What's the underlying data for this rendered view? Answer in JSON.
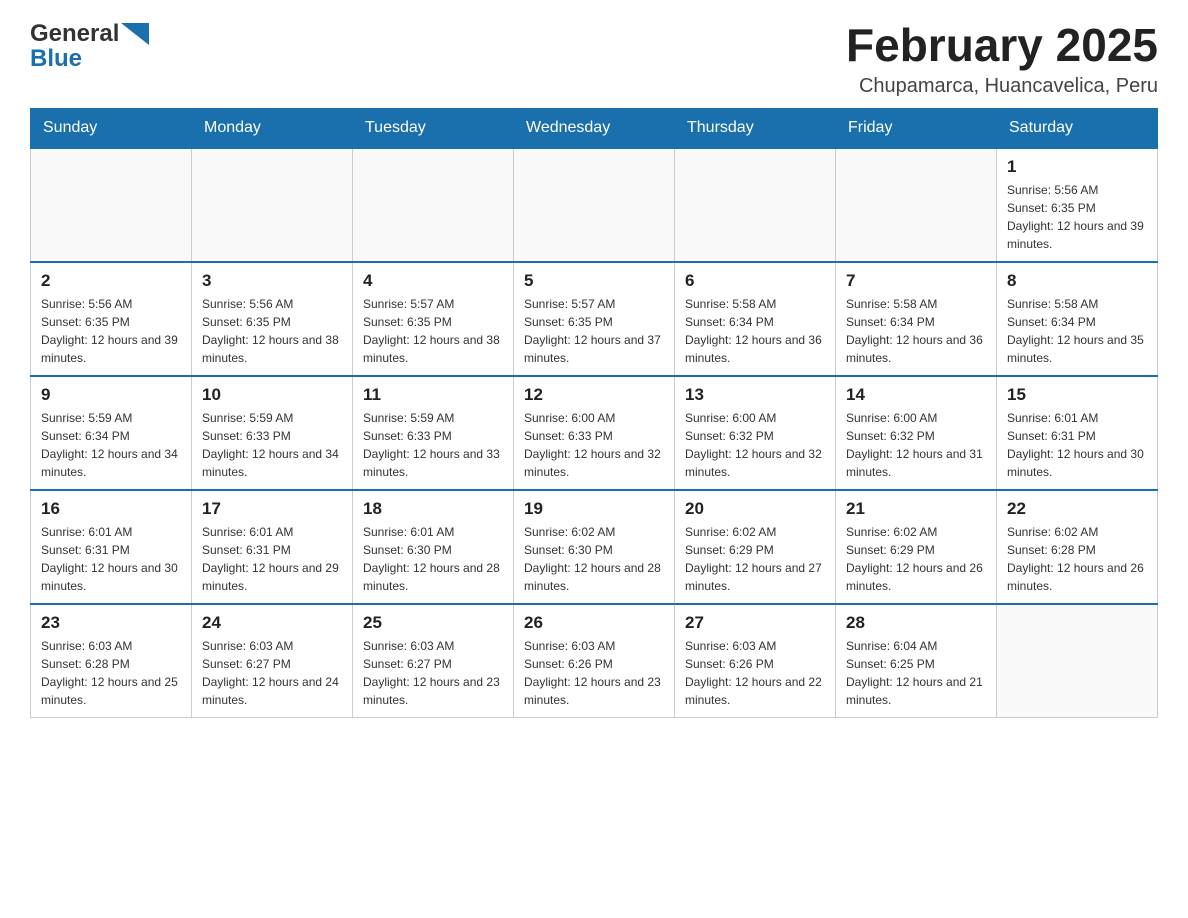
{
  "header": {
    "logo_line1": "General",
    "logo_line2": "Blue",
    "month_title": "February 2025",
    "location": "Chupamarca, Huancavelica, Peru"
  },
  "weekdays": [
    "Sunday",
    "Monday",
    "Tuesday",
    "Wednesday",
    "Thursday",
    "Friday",
    "Saturday"
  ],
  "weeks": [
    [
      {
        "day": "",
        "sunrise": "",
        "sunset": "",
        "daylight": ""
      },
      {
        "day": "",
        "sunrise": "",
        "sunset": "",
        "daylight": ""
      },
      {
        "day": "",
        "sunrise": "",
        "sunset": "",
        "daylight": ""
      },
      {
        "day": "",
        "sunrise": "",
        "sunset": "",
        "daylight": ""
      },
      {
        "day": "",
        "sunrise": "",
        "sunset": "",
        "daylight": ""
      },
      {
        "day": "",
        "sunrise": "",
        "sunset": "",
        "daylight": ""
      },
      {
        "day": "1",
        "sunrise": "Sunrise: 5:56 AM",
        "sunset": "Sunset: 6:35 PM",
        "daylight": "Daylight: 12 hours and 39 minutes."
      }
    ],
    [
      {
        "day": "2",
        "sunrise": "Sunrise: 5:56 AM",
        "sunset": "Sunset: 6:35 PM",
        "daylight": "Daylight: 12 hours and 39 minutes."
      },
      {
        "day": "3",
        "sunrise": "Sunrise: 5:56 AM",
        "sunset": "Sunset: 6:35 PM",
        "daylight": "Daylight: 12 hours and 38 minutes."
      },
      {
        "day": "4",
        "sunrise": "Sunrise: 5:57 AM",
        "sunset": "Sunset: 6:35 PM",
        "daylight": "Daylight: 12 hours and 38 minutes."
      },
      {
        "day": "5",
        "sunrise": "Sunrise: 5:57 AM",
        "sunset": "Sunset: 6:35 PM",
        "daylight": "Daylight: 12 hours and 37 minutes."
      },
      {
        "day": "6",
        "sunrise": "Sunrise: 5:58 AM",
        "sunset": "Sunset: 6:34 PM",
        "daylight": "Daylight: 12 hours and 36 minutes."
      },
      {
        "day": "7",
        "sunrise": "Sunrise: 5:58 AM",
        "sunset": "Sunset: 6:34 PM",
        "daylight": "Daylight: 12 hours and 36 minutes."
      },
      {
        "day": "8",
        "sunrise": "Sunrise: 5:58 AM",
        "sunset": "Sunset: 6:34 PM",
        "daylight": "Daylight: 12 hours and 35 minutes."
      }
    ],
    [
      {
        "day": "9",
        "sunrise": "Sunrise: 5:59 AM",
        "sunset": "Sunset: 6:34 PM",
        "daylight": "Daylight: 12 hours and 34 minutes."
      },
      {
        "day": "10",
        "sunrise": "Sunrise: 5:59 AM",
        "sunset": "Sunset: 6:33 PM",
        "daylight": "Daylight: 12 hours and 34 minutes."
      },
      {
        "day": "11",
        "sunrise": "Sunrise: 5:59 AM",
        "sunset": "Sunset: 6:33 PM",
        "daylight": "Daylight: 12 hours and 33 minutes."
      },
      {
        "day": "12",
        "sunrise": "Sunrise: 6:00 AM",
        "sunset": "Sunset: 6:33 PM",
        "daylight": "Daylight: 12 hours and 32 minutes."
      },
      {
        "day": "13",
        "sunrise": "Sunrise: 6:00 AM",
        "sunset": "Sunset: 6:32 PM",
        "daylight": "Daylight: 12 hours and 32 minutes."
      },
      {
        "day": "14",
        "sunrise": "Sunrise: 6:00 AM",
        "sunset": "Sunset: 6:32 PM",
        "daylight": "Daylight: 12 hours and 31 minutes."
      },
      {
        "day": "15",
        "sunrise": "Sunrise: 6:01 AM",
        "sunset": "Sunset: 6:31 PM",
        "daylight": "Daylight: 12 hours and 30 minutes."
      }
    ],
    [
      {
        "day": "16",
        "sunrise": "Sunrise: 6:01 AM",
        "sunset": "Sunset: 6:31 PM",
        "daylight": "Daylight: 12 hours and 30 minutes."
      },
      {
        "day": "17",
        "sunrise": "Sunrise: 6:01 AM",
        "sunset": "Sunset: 6:31 PM",
        "daylight": "Daylight: 12 hours and 29 minutes."
      },
      {
        "day": "18",
        "sunrise": "Sunrise: 6:01 AM",
        "sunset": "Sunset: 6:30 PM",
        "daylight": "Daylight: 12 hours and 28 minutes."
      },
      {
        "day": "19",
        "sunrise": "Sunrise: 6:02 AM",
        "sunset": "Sunset: 6:30 PM",
        "daylight": "Daylight: 12 hours and 28 minutes."
      },
      {
        "day": "20",
        "sunrise": "Sunrise: 6:02 AM",
        "sunset": "Sunset: 6:29 PM",
        "daylight": "Daylight: 12 hours and 27 minutes."
      },
      {
        "day": "21",
        "sunrise": "Sunrise: 6:02 AM",
        "sunset": "Sunset: 6:29 PM",
        "daylight": "Daylight: 12 hours and 26 minutes."
      },
      {
        "day": "22",
        "sunrise": "Sunrise: 6:02 AM",
        "sunset": "Sunset: 6:28 PM",
        "daylight": "Daylight: 12 hours and 26 minutes."
      }
    ],
    [
      {
        "day": "23",
        "sunrise": "Sunrise: 6:03 AM",
        "sunset": "Sunset: 6:28 PM",
        "daylight": "Daylight: 12 hours and 25 minutes."
      },
      {
        "day": "24",
        "sunrise": "Sunrise: 6:03 AM",
        "sunset": "Sunset: 6:27 PM",
        "daylight": "Daylight: 12 hours and 24 minutes."
      },
      {
        "day": "25",
        "sunrise": "Sunrise: 6:03 AM",
        "sunset": "Sunset: 6:27 PM",
        "daylight": "Daylight: 12 hours and 23 minutes."
      },
      {
        "day": "26",
        "sunrise": "Sunrise: 6:03 AM",
        "sunset": "Sunset: 6:26 PM",
        "daylight": "Daylight: 12 hours and 23 minutes."
      },
      {
        "day": "27",
        "sunrise": "Sunrise: 6:03 AM",
        "sunset": "Sunset: 6:26 PM",
        "daylight": "Daylight: 12 hours and 22 minutes."
      },
      {
        "day": "28",
        "sunrise": "Sunrise: 6:04 AM",
        "sunset": "Sunset: 6:25 PM",
        "daylight": "Daylight: 12 hours and 21 minutes."
      },
      {
        "day": "",
        "sunrise": "",
        "sunset": "",
        "daylight": ""
      }
    ]
  ]
}
